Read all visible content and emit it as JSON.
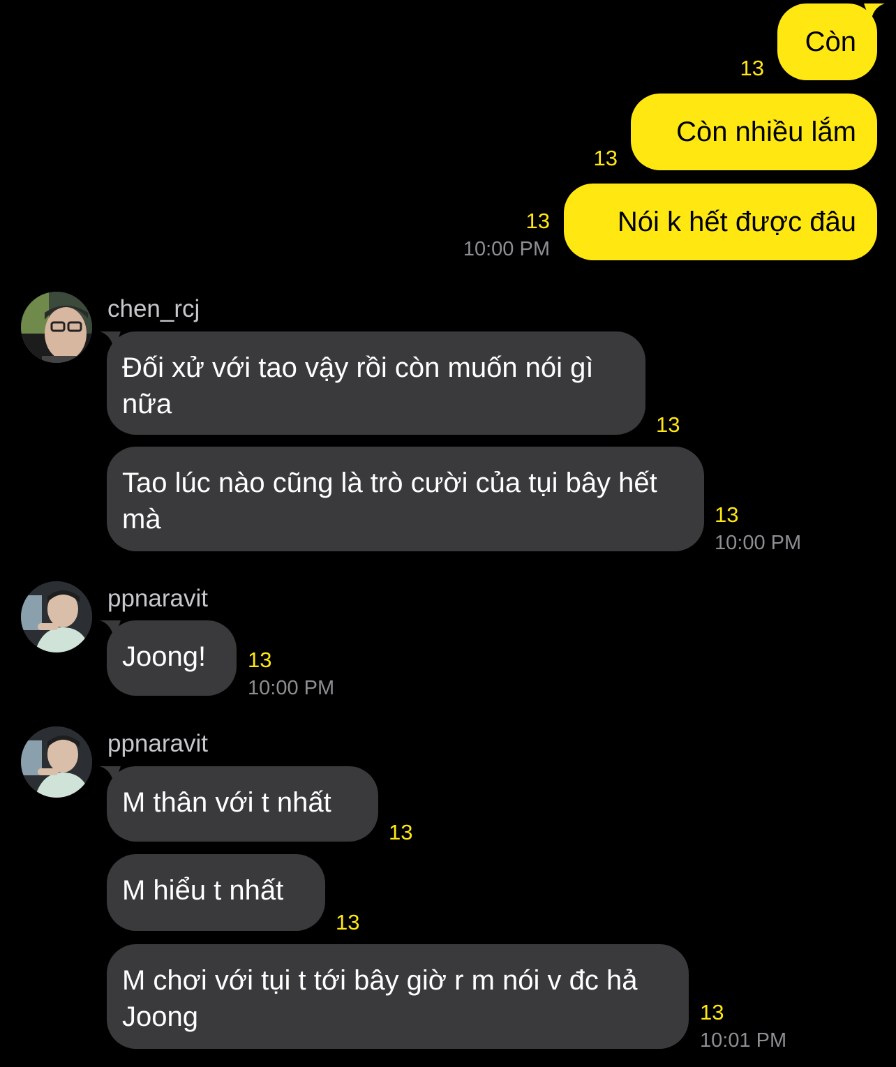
{
  "colors": {
    "background": "#000000",
    "outgoing_bubble": "#FFE812",
    "incoming_bubble": "#3A3A3C",
    "unread_count": "#FFE812",
    "timestamp": "#8E8E93"
  },
  "outgoing": [
    {
      "text": "Còn",
      "unread": "13"
    },
    {
      "text": "Còn nhiều lắm",
      "unread": "13"
    },
    {
      "text": "Nói k hết được đâu",
      "unread": "13",
      "time": "10:00 PM"
    }
  ],
  "groups": [
    {
      "sender": "chen_rcj",
      "avatar_icon": "profile-photo-icon",
      "messages": [
        {
          "text": "Đối xử với tao vậy rồi còn muốn nói gì nữa",
          "unread": "13"
        },
        {
          "text": "Tao lúc nào cũng là trò cười của tụi bây hết mà",
          "unread": "13",
          "time": "10:00 PM"
        }
      ]
    },
    {
      "sender": "ppnaravit",
      "avatar_icon": "profile-photo-icon",
      "messages": [
        {
          "text": "Joong!",
          "unread": "13",
          "time": "10:00 PM"
        }
      ]
    },
    {
      "sender": "ppnaravit",
      "avatar_icon": "profile-photo-icon",
      "messages": [
        {
          "text": "M thân với t nhất",
          "unread": "13"
        },
        {
          "text": "M hiểu t nhất",
          "unread": "13"
        },
        {
          "text": "M chơi với tụi t tới bây giờ r m nói v đc hả Joong",
          "unread": "13",
          "time": "10:01 PM"
        }
      ]
    }
  ]
}
